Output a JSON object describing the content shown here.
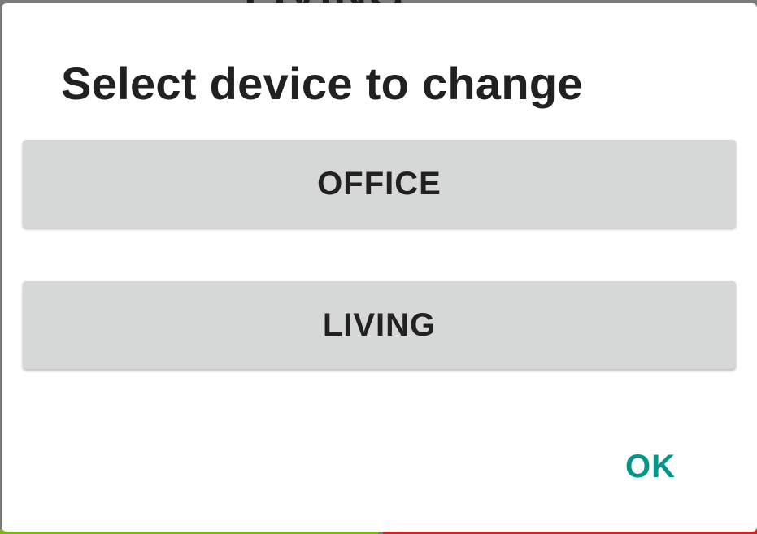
{
  "background": {
    "header_text": "LIVING"
  },
  "dialog": {
    "title": "Select device to change",
    "devices": [
      {
        "label": "OFFICE"
      },
      {
        "label": "LIVING"
      }
    ],
    "ok_label": "OK"
  },
  "colors": {
    "accent": "#009688",
    "button_bg": "#d6d7d7",
    "status_green": "#7cb518",
    "status_red": "#c62828"
  }
}
